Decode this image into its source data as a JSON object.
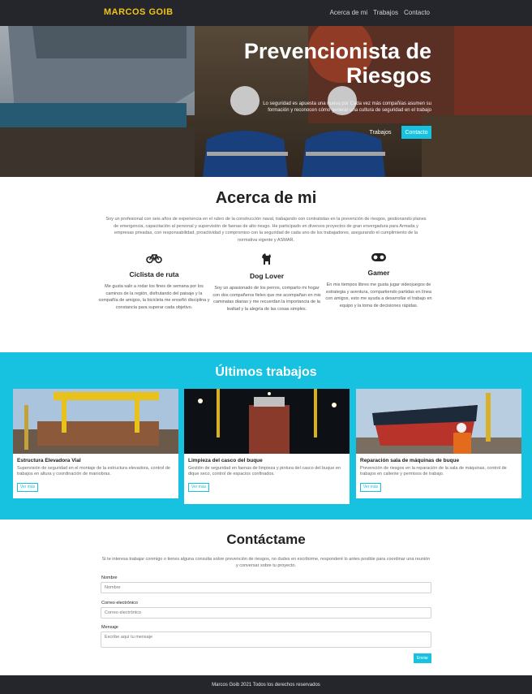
{
  "nav": {
    "brand": "MARCOS GOIB",
    "links": [
      "Acerca de mi",
      "Trabajos",
      "Contacto"
    ]
  },
  "hero": {
    "title": "Prevencionista de Riesgos",
    "subtitle": "Lo seguridad es apuesta una nueva por Cada vez más compañías asumen su formación y reconocen cómo generar una cultura de seguridad en el trabajo",
    "btn_works": "Trabajos",
    "btn_contact": "Contacto"
  },
  "about": {
    "title": "Acerca de mi",
    "text": "Soy un profesional con seis años de experiencia en el rubro de la construcción naval, trabajando con contratistas en la prevención de riesgos, gestionando planes de emergencia, capacitación al personal y supervisión de faenas de alto riesgo. He participado en diversos proyectos de gran envergadura para Armada y empresas privadas, con responsabilidad, proactividad y compromiso con la seguridad de cada uno de los trabajadores, asegurando el cumplimiento de la normativa vigente y ASMAR.",
    "hobbies": [
      {
        "icon": "bicycle-icon",
        "title": "Ciclista de ruta",
        "text": "Me gusta salir a rodar los fines de semana por los caminos de la región, disfrutando del paisaje y la compañía de amigos, la bicicleta me enseñó disciplina y constancia para superar cada objetivo."
      },
      {
        "icon": "dog-icon",
        "title": "Dog Lover",
        "text": "Soy un apasionado de los perros, comparto mi hogar con dos compañeros fieles que me acompañan en mis caminatas diarias y me recuerdan la importancia de la lealtad y la alegría de las cosas simples."
      },
      {
        "icon": "gamepad-icon",
        "title": "Gamer",
        "text": "En mis tiempos libres me gusta jugar videojuegos de estrategia y aventura, compartiendo partidas en línea con amigos, esto me ayuda a desarrollar el trabajo en equipo y la toma de decisiones rápidas."
      }
    ]
  },
  "works": {
    "title": "Últimos trabajos",
    "cards": [
      {
        "title": "Estructura Elevadora Vial",
        "text": "Supervisión de seguridad en el montaje de la estructura elevadora, control de trabajos en altura y coordinación de maniobras.",
        "button": "Ver más"
      },
      {
        "title": "Limpieza del casco del buque",
        "text": "Gestión de seguridad en faenas de limpieza y pintura del casco del buque en dique seco, control de espacios confinados.",
        "button": "Ver más"
      },
      {
        "title": "Reparación sala de máquinas de buque",
        "text": "Prevención de riesgos en la reparación de la sala de máquinas, control de trabajos en caliente y permisos de trabajo.",
        "button": "Ver más"
      }
    ]
  },
  "contact": {
    "title": "Contáctame",
    "text": "Si te interesa trabajar conmigo o tienes alguna consulta sobre prevención de riesgos, no dudes en escribirme, responderé lo antes posible para coordinar una reunión y conversar sobre tu proyecto.",
    "name_label": "Nombre",
    "name_placeholder": "Nombre",
    "email_label": "Correo electrónico",
    "email_placeholder": "Correo electrónico",
    "message_label": "Mensaje",
    "message_placeholder": "Escribe aquí tu mensaje",
    "send": "Enviar"
  },
  "footer": {
    "text": "Marcos Goib 2021 Todos los derechos reservados"
  },
  "colors": {
    "accent": "#17c2e0",
    "brand": "#f0c419",
    "dark": "#24262b"
  }
}
